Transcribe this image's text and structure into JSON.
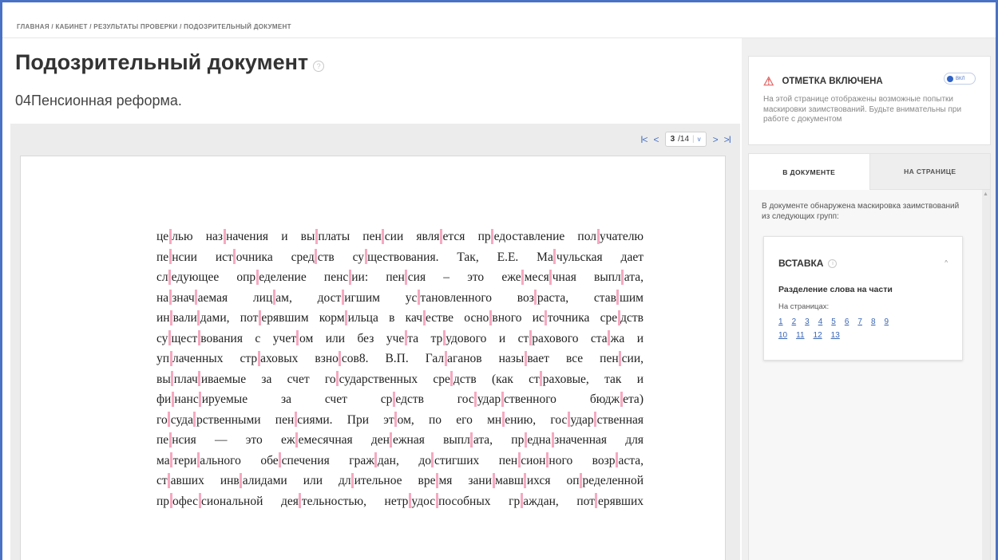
{
  "breadcrumb": "ГЛАВНАЯ / КАБИНЕТ / РЕЗУЛЬТАТЫ ПРОВЕРКИ / ПОДОЗРИТЕЛЬНЫЙ ДОКУМЕНТ",
  "page_title": "Подозрительный документ",
  "help_glyph": "?",
  "document_name": "04Пенсионная реформа.",
  "pager": {
    "first": "I<",
    "prev": "<",
    "current": "3",
    "total": "/14",
    "dropdown": "v",
    "next": ">",
    "last": ">I"
  },
  "document_lines": [
    "целью назначения и выплаты пенсии является предоставление получателю",
    "пенсии источника средств существования. Так, Е.Е. Мачульская дает",
    "следующее определение пенсии:  пенсия – это ежемесячная выплата,",
    "назначаемая лицам, достигшим установленного возраста, ставшим",
    "инвалидами, потерявшим кормильца в качестве основного источника средств",
    "существования с учетом или без учета трудового  и страхового стажа и",
    "уплаченных страховых взносов8. В.П. Галаганов называет все пенсии,",
    "выплачиваемые за счет государственных средств (как страховые, так и",
    "финансируемые    за    счет    средств    государственного    бюджета)",
    "государственными пенсиями. При этом, по его мнению, государственная",
    "пенсия — это ежемесячная денежная выплата, предназначенная для",
    "материального обеспечения граждан, достигших пенсионного возраста,",
    "ставших инвалидами или длительное время занимавшихся определенной",
    "профессиональной деятельностью, нетрудоспособных граждан, потерявших"
  ],
  "alert": {
    "title": "ОТМЕТКА ВКЛЮЧЕНА",
    "toggle_label": "ВКЛ",
    "text": "На этой странице отображены возможные попытки маскировки заимствований. Будьте внимательны при работе с документом"
  },
  "tabs": {
    "in_document": "В ДОКУМЕНТЕ",
    "on_page": "НА СТРАНИЦЕ"
  },
  "tab_intro": "В документе обнаружена маскировка заимствований из следующих групп:",
  "group": {
    "title": "ВСТАВКА",
    "info_glyph": "i",
    "subtitle": "Разделение слова на части",
    "pages_label": "На страницах:",
    "pages": [
      "1",
      "2",
      "3",
      "4",
      "5",
      "6",
      "7",
      "8",
      "9",
      "10",
      "11",
      "12",
      "13"
    ]
  },
  "colors": {
    "accent": "#4a72c4",
    "mark": "#f6a9c1",
    "warning": "#e36a6a",
    "link": "#3a66b4"
  }
}
